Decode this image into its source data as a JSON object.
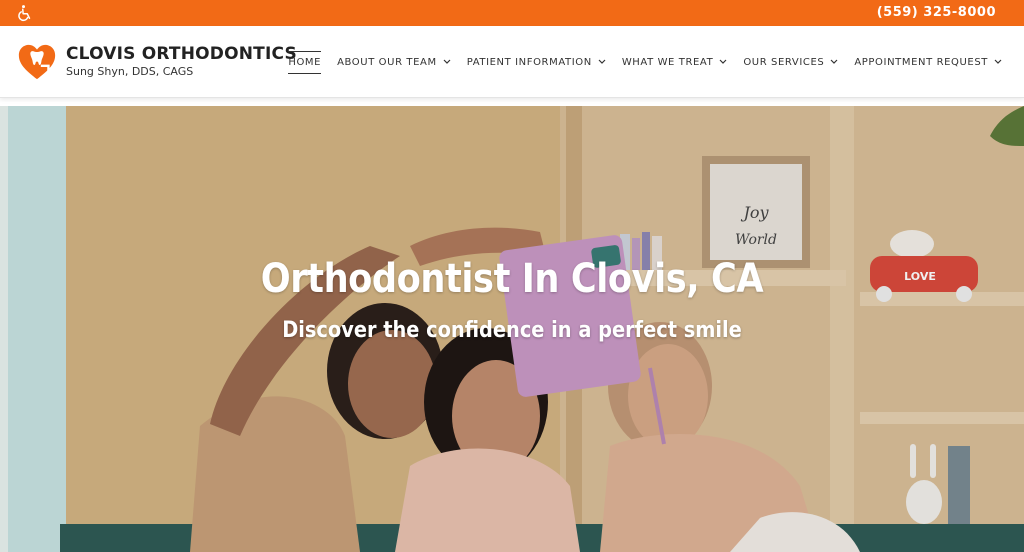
{
  "topbar": {
    "accessibility_icon": "wheelchair-icon",
    "phone": "(559) 325-8000",
    "color": "#f26a16"
  },
  "brand": {
    "title": "CLOVIS ORTHODONTICS",
    "subtitle": "Sung Shyn, DDS, CAGS",
    "logo_icon": "heart-tooth-logo-icon",
    "accent": "#f26a16"
  },
  "nav": {
    "items": [
      {
        "label": "HOME",
        "active": true,
        "dropdown": false
      },
      {
        "label": "ABOUT OUR TEAM",
        "dropdown": true
      },
      {
        "label": "PATIENT INFORMATION",
        "dropdown": true
      },
      {
        "label": "WHAT WE TREAT",
        "dropdown": true
      },
      {
        "label": "OUR SERVICES",
        "dropdown": true
      },
      {
        "label": "APPOINTMENT REQUEST",
        "dropdown": true
      }
    ]
  },
  "hero": {
    "title": "Orthodontist In Clovis, CA",
    "subtitle": "Discover the confidence in a perfect smile",
    "sign_text_1": "Joy",
    "sign_text_2": "World",
    "toy_car_text": "LOVE"
  }
}
